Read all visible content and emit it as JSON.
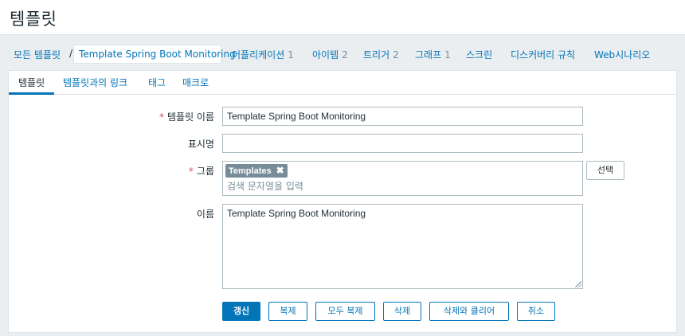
{
  "header": {
    "title": "템플릿"
  },
  "nav": {
    "all_templates": "모든 템플릿",
    "separator": "/",
    "current": "Template Spring Boot Monitoring",
    "items": [
      {
        "label": "어플리케이션",
        "count": "1"
      },
      {
        "label": "아이템",
        "count": "2"
      },
      {
        "label": "트리거",
        "count": "2"
      },
      {
        "label": "그래프",
        "count": "1"
      },
      {
        "label": "스크린",
        "count": ""
      },
      {
        "label": "디스커버리 규칙",
        "count": ""
      },
      {
        "label": "Web시나리오",
        "count": ""
      }
    ]
  },
  "tabs": [
    {
      "label": "템플릿"
    },
    {
      "label": "템플릿과의 링크"
    },
    {
      "label": "태그"
    },
    {
      "label": "매크로"
    }
  ],
  "form": {
    "required_mark": "*",
    "template_name_label": "템플릿 이름",
    "template_name_value": "Template Spring Boot Monitoring",
    "visible_name_label": "표시명",
    "visible_name_value": "",
    "groups_label": "그룹",
    "group_tag": "Templates",
    "group_tag_remove": "✖",
    "group_placeholder": "검색 문자열을 입력",
    "select_button": "선택",
    "description_label": "이름",
    "description_value": "Template Spring Boot Monitoring"
  },
  "buttons": {
    "update": "갱신",
    "clone": "복제",
    "full_clone": "모두 복제",
    "delete": "삭제",
    "delete_clear": "삭제와 클리어",
    "cancel": "취소"
  }
}
